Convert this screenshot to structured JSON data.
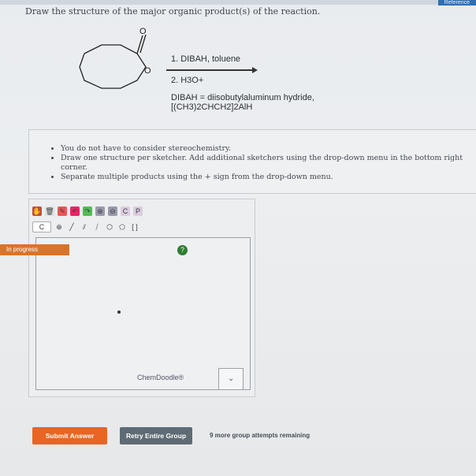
{
  "header": {
    "reference_label": "Reference"
  },
  "question": "Draw the structure of the major organic product(s) of the reaction.",
  "reaction": {
    "oxygen_top": "O",
    "oxygen_ring": "O",
    "step1": "1. DIBAH, toluene",
    "step2": "2. H3O+",
    "definition_line1": "DIBAH = diisobutylaluminum hydride,",
    "definition_line2": "[(CH3)2CHCH2]2AlH"
  },
  "hints": [
    "You do not have to consider stereochemistry.",
    "Draw one structure per sketcher. Add additional sketchers using the drop-down menu in the bottom right corner.",
    "Separate multiple products using the + sign from the drop-down menu."
  ],
  "sketcher": {
    "status": "In progress",
    "brand": "ChemDoodle®",
    "toolbar_row2_label": "C"
  },
  "actions": {
    "submit": "Submit Answer",
    "retry": "Retry Entire Group",
    "attempts": "9 more group attempts remaining"
  }
}
